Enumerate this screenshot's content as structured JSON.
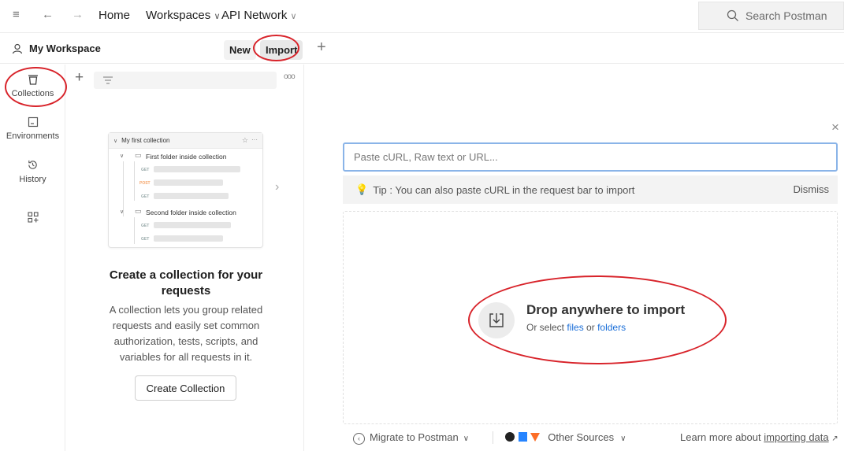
{
  "topbar": {
    "menu_icon": "hamburger-icon",
    "back_icon": "arrow-left-icon",
    "forward_icon": "arrow-right-icon",
    "home": "Home",
    "workspaces": "Workspaces",
    "api_network": "API Network",
    "search_placeholder": "Search Postman"
  },
  "workspace": {
    "name": "My Workspace",
    "new_label": "New",
    "import_label": "Import"
  },
  "rail": {
    "collections": "Collections",
    "environments": "Environments",
    "history": "History"
  },
  "illustration": {
    "collection": "My first collection",
    "folder1": "First folder inside collection",
    "folder2": "Second folder inside collection",
    "get": "GET",
    "post": "POST"
  },
  "empty_state": {
    "title": "Create a collection for your requests",
    "description": "A collection lets you group related requests and easily set common authorization, tests, scripts, and variables for all requests in it.",
    "button": "Create Collection"
  },
  "import": {
    "url_placeholder": "Paste cURL, Raw text or URL...",
    "tip": "Tip : You can also paste cURL in the request bar to import",
    "dismiss": "Dismiss",
    "drop_title": "Drop anywhere to import",
    "drop_or_select": "Or select",
    "files": "files",
    "or": "or",
    "folders": "folders",
    "migrate": "Migrate to Postman",
    "other_sources": "Other Sources",
    "learn_more": "Learn more about",
    "importing_data": "importing data"
  },
  "colors": {
    "annotation": "#d8232a",
    "link": "#1a6ed8",
    "focus": "#8ab4e8"
  }
}
